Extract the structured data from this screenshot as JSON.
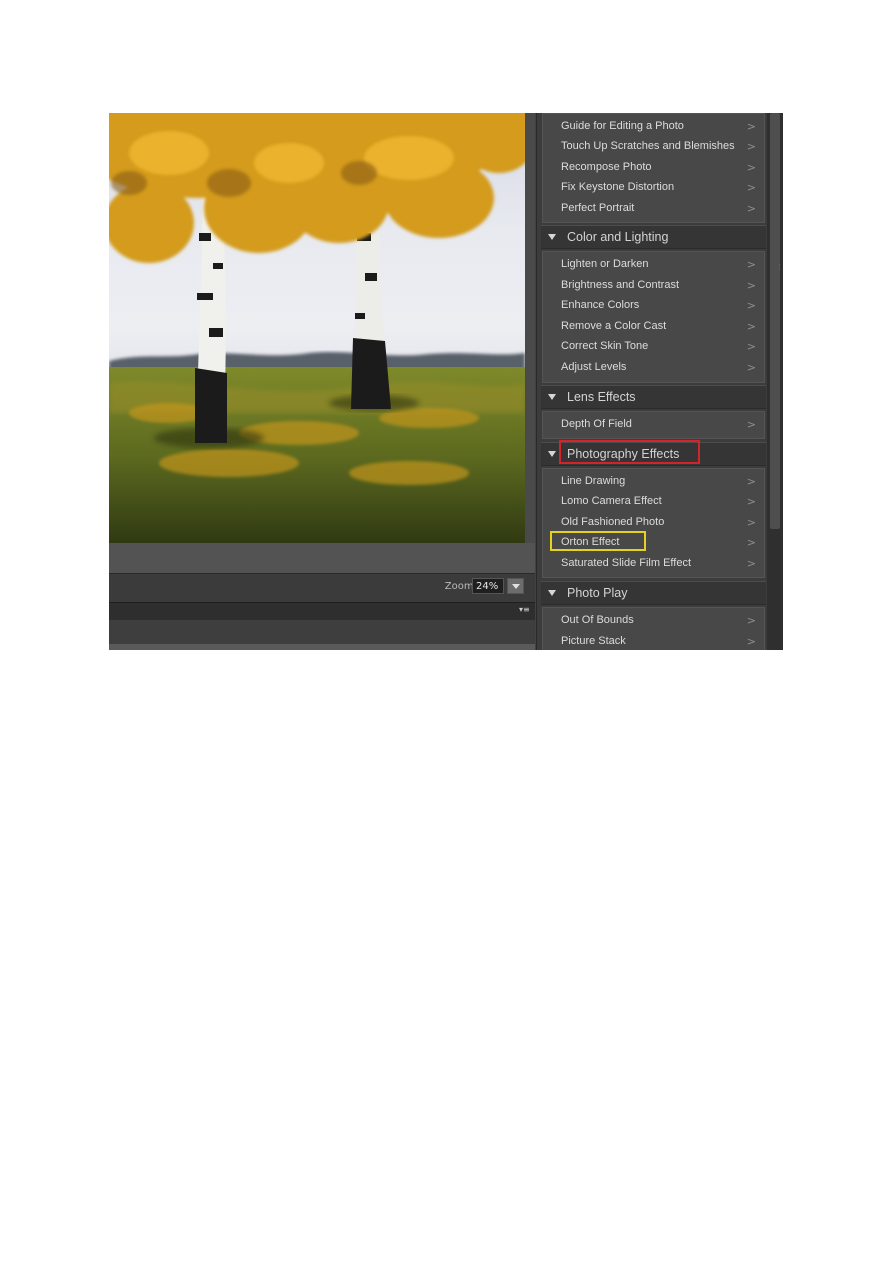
{
  "canvas": {
    "zoom_label": "Zoom:",
    "zoom_value": "24%"
  },
  "panel": {
    "sections": [
      {
        "title": "",
        "items": [
          {
            "label": "Guide for Editing a Photo"
          },
          {
            "label": "Touch Up Scratches and Blemishes"
          },
          {
            "label": "Recompose Photo"
          },
          {
            "label": "Fix Keystone Distortion"
          },
          {
            "label": "Perfect Portrait"
          }
        ]
      },
      {
        "title": "Color and Lighting",
        "items": [
          {
            "label": "Lighten or Darken"
          },
          {
            "label": "Brightness and Contrast"
          },
          {
            "label": "Enhance Colors"
          },
          {
            "label": "Remove a Color Cast"
          },
          {
            "label": "Correct Skin Tone"
          },
          {
            "label": "Adjust Levels"
          }
        ]
      },
      {
        "title": "Lens Effects",
        "items": [
          {
            "label": "Depth Of Field"
          }
        ]
      },
      {
        "title": "Photography Effects",
        "highlight": "red",
        "items": [
          {
            "label": "Line Drawing"
          },
          {
            "label": "Lomo Camera Effect"
          },
          {
            "label": "Old Fashioned Photo"
          },
          {
            "label": "Orton Effect",
            "highlight": "yellow"
          },
          {
            "label": "Saturated Slide Film Effect"
          }
        ]
      },
      {
        "title": "Photo Play",
        "items": [
          {
            "label": "Out Of Bounds"
          },
          {
            "label": "Picture Stack"
          }
        ]
      }
    ],
    "chevron_glyph": ">"
  },
  "colors": {
    "highlight_red": "#d4232b",
    "highlight_yellow": "#e5d21c",
    "panel_bg": "#3c3c3c"
  }
}
